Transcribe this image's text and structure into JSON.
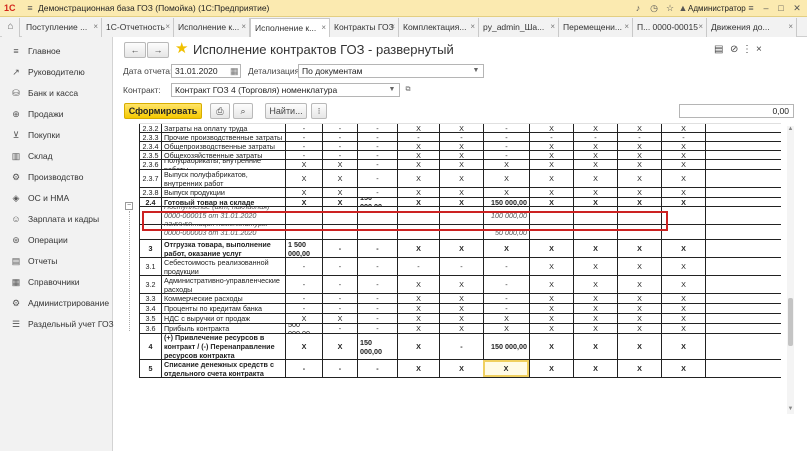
{
  "window": {
    "title": "Демонстрационная база ГОЗ (Помойка)  (1С:Предприятие)",
    "user": "Администратор",
    "logo": "1С"
  },
  "tabs": [
    {
      "label": "Поступление ..."
    },
    {
      "label": "1С-Отчетность"
    },
    {
      "label": "Исполнение к..."
    },
    {
      "label": "Исполнение к..."
    },
    {
      "label": "Контракты ГОЗ"
    },
    {
      "label": "Комплектация..."
    },
    {
      "label": "py_admin_Ша..."
    },
    {
      "label": "Перемещени..."
    },
    {
      "label": "П... 0000-00015"
    },
    {
      "label": "Движения до..."
    }
  ],
  "sidebar": {
    "items": [
      {
        "label": "Главное",
        "icon": "menu-icon"
      },
      {
        "label": "Руководителю",
        "icon": "chart-icon"
      },
      {
        "label": "Банк и касса",
        "icon": "bank-icon"
      },
      {
        "label": "Продажи",
        "icon": "sales-icon"
      },
      {
        "label": "Покупки",
        "icon": "cart-icon"
      },
      {
        "label": "Склад",
        "icon": "warehouse-icon"
      },
      {
        "label": "Производство",
        "icon": "factory-icon"
      },
      {
        "label": "ОС и НМА",
        "icon": "assets-icon"
      },
      {
        "label": "Зарплата и кадры",
        "icon": "people-icon"
      },
      {
        "label": "Операции",
        "icon": "operations-icon"
      },
      {
        "label": "Отчеты",
        "icon": "reports-icon"
      },
      {
        "label": "Справочники",
        "icon": "book-icon"
      },
      {
        "label": "Администрирование",
        "icon": "gear-icon"
      },
      {
        "label": "Раздельный учет ГОЗ",
        "icon": "list-icon"
      }
    ]
  },
  "page": {
    "title": "Исполнение контрактов ГОЗ - развернутый",
    "nav_back": "←",
    "nav_forward": "→",
    "star": "★",
    "more": "⋮",
    "report_date_label": "Дата отчета:",
    "report_date": "31.01.2020",
    "detail_label": "Детализация:",
    "detail_value": "По документам",
    "contract_label": "Контракт:",
    "contract_value": "Контракт ГОЗ 4 (Торговля) номенклатура",
    "generate_label": "Сформировать",
    "find_label": "Найти...",
    "amount_value": "0,00"
  },
  "table": {
    "rows": [
      {
        "n": "2.3.2",
        "name": "Затраты на оплату труда",
        "c": [
          "-",
          "-",
          "-",
          "X",
          "X",
          "-",
          "X",
          "X",
          "X",
          "X"
        ]
      },
      {
        "n": "2.3.3",
        "name": "Прочие производственные затраты",
        "c": [
          "-",
          "-",
          "-",
          "-",
          "-",
          "-",
          "-",
          "-",
          "-",
          "-"
        ]
      },
      {
        "n": "2.3.4",
        "name": "Общепроизводственные затраты",
        "c": [
          "-",
          "-",
          "-",
          "X",
          "X",
          "-",
          "X",
          "X",
          "X",
          "X"
        ]
      },
      {
        "n": "2.3.5",
        "name": "Общехозяйственные затраты",
        "c": [
          "-",
          "-",
          "-",
          "X",
          "X",
          "-",
          "X",
          "X",
          "X",
          "X"
        ]
      },
      {
        "n": "2.3.6",
        "name": "Полуфабрикаты, внутренние работы",
        "c": [
          "X",
          "X",
          "-",
          "X",
          "X",
          "X",
          "X",
          "X",
          "X",
          "X"
        ]
      },
      {
        "n": "2.3.7",
        "name": "Выпуск полуфабрикатов, внутренних работ",
        "c": [
          "X",
          "X",
          "-",
          "X",
          "X",
          "X",
          "X",
          "X",
          "X",
          "X"
        ]
      },
      {
        "n": "2.3.8",
        "name": "Выпуск продукции",
        "c": [
          "X",
          "X",
          "-",
          "X",
          "X",
          "X",
          "X",
          "X",
          "X",
          "X"
        ]
      },
      {
        "n": "2.4",
        "name": "Готовый товар на складе",
        "c": [
          "X",
          "X",
          "150 000,00",
          "X",
          "X",
          "150 000,00",
          "X",
          "X",
          "X",
          "X"
        ]
      },
      {
        "n": "",
        "name": "Поступление (акт, накладная) 0000-000015 от 31.01.2020 23:59:59",
        "c": [
          "",
          "",
          "",
          "",
          "",
          "100 000,00",
          "",
          "",
          "",
          ""
        ]
      },
      {
        "n": "",
        "name": "Комплектация номенклатуры 0000-000003 от 31.01.2020 23:59:59",
        "c": [
          "",
          "",
          "",
          "",
          "",
          "50 000,00",
          "",
          "",
          "",
          ""
        ]
      },
      {
        "n": "3",
        "name": "Отгрузка товара, выполнение работ, оказание услуг",
        "c": [
          "1 500 000,00",
          "-",
          "-",
          "X",
          "X",
          "X",
          "X",
          "X",
          "X",
          "X"
        ]
      },
      {
        "n": "3.1",
        "name": "Себестоимость реализованной продукции",
        "c": [
          "-",
          "-",
          "-",
          "-",
          "-",
          "-",
          "X",
          "X",
          "X",
          "X"
        ]
      },
      {
        "n": "3.2",
        "name": "Административно-управленческие расходы",
        "c": [
          "-",
          "-",
          "-",
          "X",
          "X",
          "-",
          "X",
          "X",
          "X",
          "X"
        ]
      },
      {
        "n": "3.3",
        "name": "Коммерческие расходы",
        "c": [
          "-",
          "-",
          "-",
          "X",
          "X",
          "-",
          "X",
          "X",
          "X",
          "X"
        ]
      },
      {
        "n": "3.4",
        "name": "Проценты по кредитам банка",
        "c": [
          "-",
          "-",
          "-",
          "X",
          "X",
          "-",
          "X",
          "X",
          "X",
          "X"
        ]
      },
      {
        "n": "3.5",
        "name": "НДС с выручки от продаж",
        "c": [
          "X",
          "X",
          "-",
          "X",
          "X",
          "X",
          "X",
          "X",
          "X",
          "X"
        ]
      },
      {
        "n": "3.6",
        "name": "Прибыль контракта",
        "c": [
          "500 000,00",
          "-",
          "-",
          "X",
          "X",
          "X",
          "X",
          "X",
          "X",
          "X"
        ]
      },
      {
        "n": "4",
        "name": "(+) Привлечение ресурсов в контракт / (-) Перенаправление ресурсов контракта",
        "c": [
          "X",
          "X",
          "150 000,00",
          "X",
          "-",
          "150 000,00",
          "X",
          "X",
          "X",
          "X"
        ]
      },
      {
        "n": "5",
        "name": "Списание денежных средств с отдельного счета контракта",
        "c": [
          "-",
          "-",
          "-",
          "X",
          "X",
          "X",
          "X",
          "X",
          "X",
          "X"
        ]
      }
    ]
  }
}
